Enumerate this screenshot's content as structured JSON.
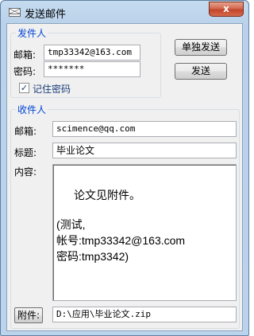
{
  "window": {
    "title": "发送邮件",
    "close_label": "x"
  },
  "sender": {
    "group_title": "发件人",
    "email_label": "邮箱:",
    "email_value": "tmp33342@163.com",
    "password_label": "密码:",
    "password_value": "*******",
    "remember_label": "记住密码",
    "remember_checked": true,
    "remember_mark": "✓"
  },
  "actions": {
    "send_single_label": "单独发送",
    "send_label": "发送"
  },
  "recipient": {
    "group_title": "收件人",
    "email_label": "邮箱:",
    "email_value": "scimence@qq.com",
    "subject_label": "标题:",
    "subject_value": "毕业论文",
    "content_label": "内容:",
    "content_lines": [
      "论文见附件。",
      "",
      "(测试,",
      "帐号:tmp33342@163.com",
      "密码:tmp3342)"
    ]
  },
  "attachment": {
    "button_label": "附件:",
    "path_value": "D:\\应用\\毕业论文.zip"
  }
}
